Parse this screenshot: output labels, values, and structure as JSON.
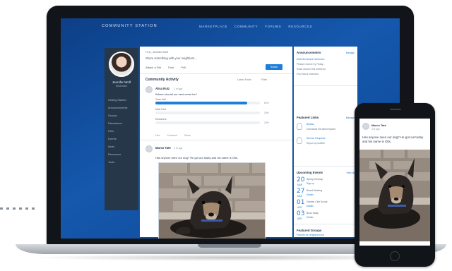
{
  "site": {
    "brand": "COMMUNITY STATION",
    "nav": [
      "MARKETPLACE",
      "COMMUNITY",
      "FORUMS",
      "RESOURCES"
    ]
  },
  "profile": {
    "name": "Jennifer Wolf",
    "role": "Moderator",
    "menu": [
      "Getting Started",
      "Announcements",
      "Groups",
      "Discussions",
      "Files",
      "Events",
      "Ideas",
      "Resources",
      "Tools"
    ]
  },
  "composer": {
    "breadcrumb": "Hi in, Jennifer Wolf",
    "prompt": "Share something with your neighbors...",
    "tabs": [
      "Attach a File",
      "Post",
      "Poll"
    ],
    "share_label": "Share"
  },
  "activity": {
    "title": "Community Activity",
    "sort": "Latest Posts",
    "filter": "Filter"
  },
  "post1": {
    "author": "Alisa Ruiz",
    "meta": "2 hr ago",
    "question": "Where should our next event be?",
    "poll": [
      {
        "label": "Town Hall",
        "pct_label": "62%",
        "fill": 0.88
      },
      {
        "label": "Main Park",
        "pct_label": "18%",
        "fill": 0.0
      },
      {
        "label": "Elsewhere",
        "pct_label": "20%",
        "fill": 0.0
      }
    ],
    "actions": [
      "Like",
      "Comment",
      "Share"
    ]
  },
  "post2": {
    "author": "Marco Tate",
    "meta": "4 hr ago",
    "text": "Has anyone seen our dog? He got out today and his name is Otis."
  },
  "announcements": {
    "title": "Announcements",
    "link": "Manage",
    "lines": [
      "Meet the Board Nominees",
      "Please reserve by Friday...",
      "Road closure this weekend",
      "Pool hours extended"
    ]
  },
  "featured": {
    "title": "Featured Links",
    "link": "Manage",
    "items": [
      {
        "name": "Bylaws",
        "desc": "Download the latest bylaws"
      },
      {
        "name": "Service Requests",
        "desc": "Report a problem"
      }
    ]
  },
  "events": {
    "title": "Upcoming Events",
    "link": "View all",
    "items": [
      {
        "day": "20",
        "mon": "MAR",
        "text": "Spring Cleanup",
        "link": "Sign up"
      },
      {
        "day": "27",
        "mon": "MAR",
        "text": "Board Meeting",
        "link": "Details"
      },
      {
        "day": "01",
        "mon": "APR",
        "text": "Garden Club Social",
        "link": "Details"
      },
      {
        "day": "03",
        "mon": "APR",
        "text": "Book Swap",
        "link": "Details"
      }
    ]
  },
  "featured_groups": {
    "title": "Featured Groups",
    "link": "Parents for Neighborhood"
  },
  "mobile": {
    "author": "Marco Tate",
    "meta": "4 hr ago",
    "text": "Has anyone seen our dog? He got out today and his name is Otis."
  }
}
